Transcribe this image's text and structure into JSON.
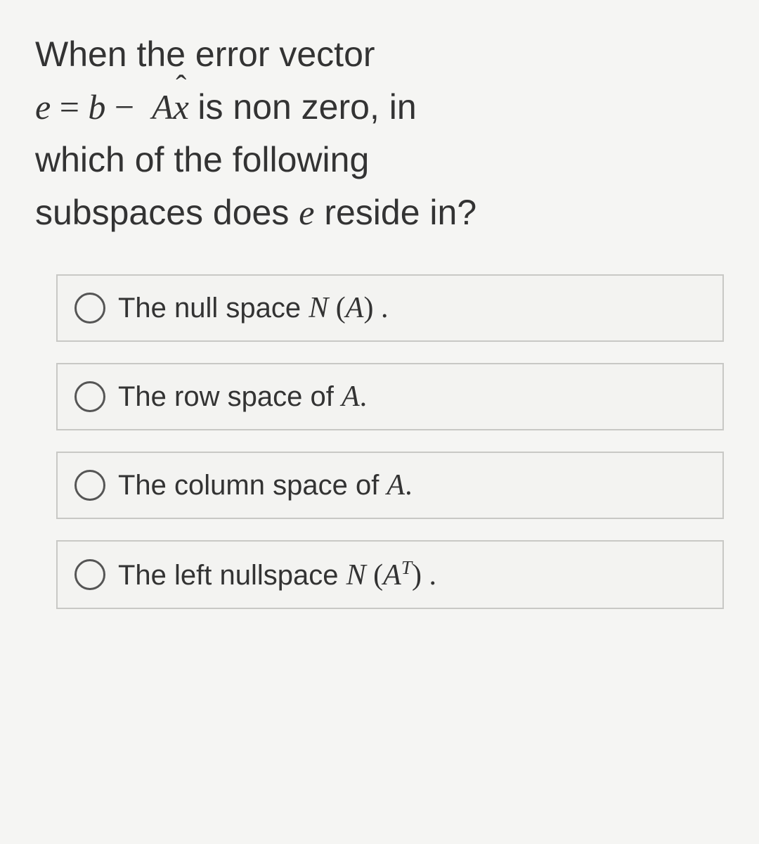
{
  "question": {
    "line1_prefix": "When the error vector",
    "eq_lhs": "e",
    "eq_eq": " = ",
    "eq_b": "b",
    "eq_minus": " − ",
    "eq_A": "A",
    "eq_xhat": "x",
    "line2_suffix": " is non zero, in",
    "line3": "which of the following",
    "line4_prefix": "subspaces does ",
    "line4_var": "e",
    "line4_suffix": "  reside in?"
  },
  "options": [
    {
      "pre": "The null space  ",
      "math_pre": "N",
      "math_open": " (",
      "math_mid": "A",
      "math_close": ") .",
      "sup": ""
    },
    {
      "pre": "The row space of  ",
      "math_pre": "",
      "math_open": "",
      "math_mid": "A",
      "math_close": ".",
      "sup": ""
    },
    {
      "pre": "The column space of  ",
      "math_pre": "",
      "math_open": "",
      "math_mid": "A",
      "math_close": ".",
      "sup": ""
    },
    {
      "pre": "The left nullspace  ",
      "math_pre": "N",
      "math_open": " (",
      "math_mid": "A",
      "math_close": ") .",
      "sup": "T"
    }
  ]
}
